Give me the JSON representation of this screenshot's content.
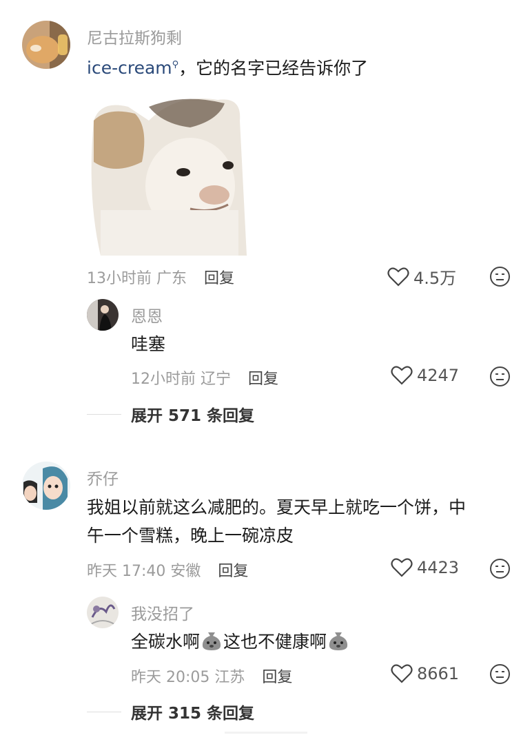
{
  "comment1": {
    "username": "尼古拉斯狗剩",
    "mention": "ice-cream",
    "text": "，它的名字已经告诉你了",
    "time": "13小时前",
    "location": "广东",
    "reply_label": "回复",
    "likes": "4.5万"
  },
  "reply1": {
    "username": "恩恩",
    "text": "哇塞",
    "time": "12小时前",
    "location": "辽宁",
    "reply_label": "回复",
    "likes": "4247"
  },
  "expand1": {
    "label": "展开 571 条回复"
  },
  "comment2": {
    "username": "乔仔",
    "text_line1": "我姐以前就这么减肥的。夏天早上就吃一个饼，中",
    "text_line2": "午一个雪糕，晚上一碗凉皮",
    "time": "昨天 17:40",
    "location": "安徽",
    "reply_label": "回复",
    "likes": "4423"
  },
  "reply2": {
    "username": "我没招了",
    "text_part1": "全碳水啊",
    "text_part2": "这也不健康啊",
    "time": "昨天 20:05",
    "location": "江苏",
    "reply_label": "回复",
    "likes": "8661"
  },
  "expand2": {
    "label": "展开 315 条回复"
  },
  "colors": {
    "link": "#2b4a7a",
    "meta": "#9b9b9b",
    "username": "#9a9a9a"
  },
  "icons": [
    "heart-outline-icon",
    "dislike-face-icon",
    "search-mention-icon",
    "money-bag-emoji"
  ]
}
